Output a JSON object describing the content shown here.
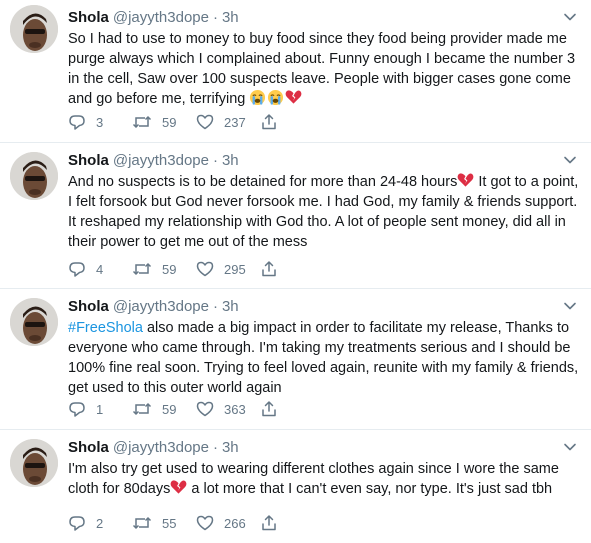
{
  "tweets": [
    {
      "name": "Shola",
      "handle": "@jayyth3dope",
      "dot": "·",
      "time": "3h",
      "text": "So I had to use to money to buy food since they food being provider made me purge always which I complained about. Funny enough I became the number 3 in the cell, Saw over 100 suspects leave. People with bigger cases gone come and go before me, terrifying",
      "replies": "3",
      "retweets": "59",
      "likes": "237"
    },
    {
      "name": "Shola",
      "handle": "@jayyth3dope",
      "dot": "·",
      "time": "3h",
      "text_a": "And no suspects is to be detained for more than 24-48 hours",
      "text_b": " It got to a point, I felt forsook but God never forsook me. I had God, my family & friends support. It reshaped my relationship with God tho. A lot of people sent money, did all in their power to get me out of the mess",
      "replies": "4",
      "retweets": "59",
      "likes": "295"
    },
    {
      "name": "Shola",
      "handle": "@jayyth3dope",
      "dot": "·",
      "time": "3h",
      "hashtag": "#FreeShola",
      "text": " also made a big impact in order to facilitate my release, Thanks to everyone who came through. I'm taking my treatments serious and I should be 100% fine real soon. Trying to feel loved again, reunite with my family & friends, get used to this outer world again",
      "replies": "1",
      "retweets": "59",
      "likes": "363"
    },
    {
      "name": "Shola",
      "handle": "@jayyth3dope",
      "dot": "·",
      "time": "3h",
      "text_a": "I'm also try get used to wearing different clothes again since I wore the same cloth for 80days",
      "text_b": " a lot more that I can't even say, nor type. It's just sad tbh",
      "replies": "2",
      "retweets": "55",
      "likes": "266"
    }
  ],
  "icons": {
    "reply": "reply-icon",
    "retweet": "retweet-icon",
    "like": "heart-outline-icon",
    "share": "share-icon",
    "menu": "chevron-down-icon",
    "crying": "loudly-crying-face-emoji",
    "broken_heart": "broken-heart-emoji"
  },
  "colors": {
    "text": "#14171a",
    "secondary": "#657786",
    "link": "#1b95e0",
    "divider": "#e6ecf0",
    "broken_heart": "#dd2e44"
  }
}
